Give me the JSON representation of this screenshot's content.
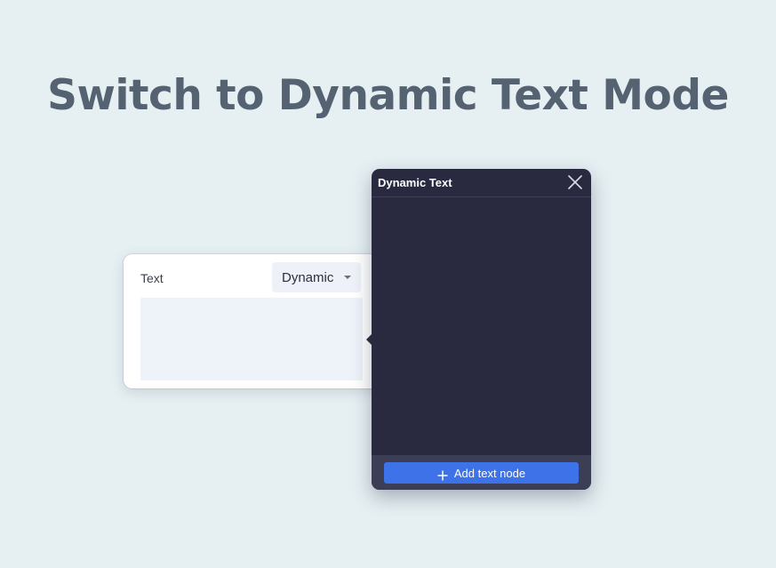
{
  "headline": "Switch to Dynamic Text Mode",
  "text_field": {
    "label": "Text",
    "mode_value": "Dynamic",
    "content": ""
  },
  "dynamic_panel": {
    "title": "Dynamic Text",
    "add_button_label": "Add text node"
  },
  "icons": {
    "close": "close-icon",
    "plus": "plus-icon",
    "dropdown": "chevron-down-icon"
  },
  "colors": {
    "background": "#e6f0f3",
    "headline": "#556271",
    "panel": "#292a40",
    "accent": "#3d72e8"
  }
}
